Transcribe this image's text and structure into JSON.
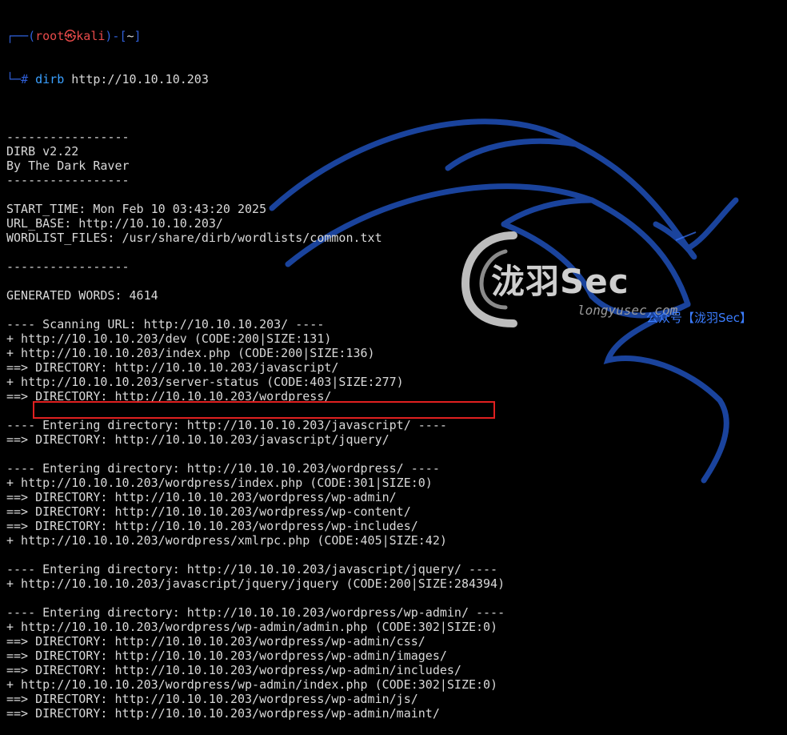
{
  "prompt": {
    "box_top": "┌──(",
    "user": "root",
    "at": "㉿",
    "host": "kali",
    "box_mid": ")-[",
    "dir": "~",
    "box_end": "]",
    "box_bottom": "└─",
    "hash": "# ",
    "command": "dirb",
    "argument": "http://10.10.10.203"
  },
  "output_lines": [
    "",
    "-----------------",
    "DIRB v2.22",
    "By The Dark Raver",
    "-----------------",
    "",
    "START_TIME: Mon Feb 10 03:43:20 2025",
    "URL_BASE: http://10.10.10.203/",
    "WORDLIST_FILES: /usr/share/dirb/wordlists/common.txt",
    "",
    "-----------------",
    "",
    "GENERATED WORDS: 4614",
    "",
    "---- Scanning URL: http://10.10.10.203/ ----",
    "+ http://10.10.10.203/dev (CODE:200|SIZE:131)",
    "+ http://10.10.10.203/index.php (CODE:200|SIZE:136)",
    "==> DIRECTORY: http://10.10.10.203/javascript/",
    "+ http://10.10.10.203/server-status (CODE:403|SIZE:277)",
    "==> DIRECTORY: http://10.10.10.203/wordpress/",
    "",
    "---- Entering directory: http://10.10.10.203/javascript/ ----",
    "==> DIRECTORY: http://10.10.10.203/javascript/jquery/",
    "",
    "---- Entering directory: http://10.10.10.203/wordpress/ ----",
    "+ http://10.10.10.203/wordpress/index.php (CODE:301|SIZE:0)",
    "==> DIRECTORY: http://10.10.10.203/wordpress/wp-admin/",
    "==> DIRECTORY: http://10.10.10.203/wordpress/wp-content/",
    "==> DIRECTORY: http://10.10.10.203/wordpress/wp-includes/",
    "+ http://10.10.10.203/wordpress/xmlrpc.php (CODE:405|SIZE:42)",
    "",
    "---- Entering directory: http://10.10.10.203/javascript/jquery/ ----",
    "+ http://10.10.10.203/javascript/jquery/jquery (CODE:200|SIZE:284394)",
    "",
    "---- Entering directory: http://10.10.10.203/wordpress/wp-admin/ ----",
    "+ http://10.10.10.203/wordpress/wp-admin/admin.php (CODE:302|SIZE:0)",
    "==> DIRECTORY: http://10.10.10.203/wordpress/wp-admin/css/",
    "==> DIRECTORY: http://10.10.10.203/wordpress/wp-admin/images/",
    "==> DIRECTORY: http://10.10.10.203/wordpress/wp-admin/includes/",
    "+ http://10.10.10.203/wordpress/wp-admin/index.php (CODE:302|SIZE:0)",
    "==> DIRECTORY: http://10.10.10.203/wordpress/wp-admin/js/",
    "==> DIRECTORY: http://10.10.10.203/wordpress/wp-admin/maint/"
  ],
  "highlighted_line": "==> DIRECTORY: http://10.10.10.203/wordpress/wp-admin/",
  "watermark": {
    "brand": "泷羽Sec",
    "site": "longyusec.com",
    "wechat": "公众号【泷羽Sec】"
  },
  "colors": {
    "background": "#000000",
    "text": "#d9d9d9",
    "prompt_box": "#2f5fd8",
    "prompt_user": "#e84a4a",
    "command": "#3aa0ff",
    "highlight_border": "#e02020",
    "dragon": "#1f4fb8"
  },
  "icons": [
    "kali-dragon-icon",
    "longyu-logo-icon"
  ]
}
